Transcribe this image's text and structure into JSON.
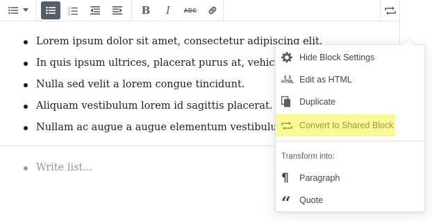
{
  "toolbar": {
    "groups": [
      {
        "name": "block-switcher",
        "icons": [
          "list-icon",
          "chevron-down-icon"
        ]
      },
      {
        "name": "list-formatting",
        "icons": [
          "bulleted-list-icon",
          "numbered-list-icon",
          "outdent-icon",
          "indent-icon"
        ],
        "active": "bulleted-list-icon"
      },
      {
        "name": "text-formatting",
        "icons": [
          "bold-icon",
          "italic-icon",
          "strikethrough-icon",
          "link-icon"
        ]
      }
    ],
    "bold_label": "B",
    "italic_label": "I",
    "strike_label": "ABC"
  },
  "side_toolbar": {
    "icon": "shared-block-icon"
  },
  "list_block": {
    "items": [
      "Lorem ipsum dolor sit amet, consectetur adipiscing elit.",
      "In quis ipsum ultrices, placerat purus at, vehicula",
      "Nulla sed velit a lorem congue tincidunt.",
      "Aliquam vestibulum lorem id sagittis placerat.",
      "Nullam ac augue a augue elementum vestibulum."
    ]
  },
  "new_block": {
    "placeholder": "Write list..."
  },
  "menu": {
    "items": [
      {
        "label": "Hide Block Settings",
        "icon": "gear-icon"
      },
      {
        "label": "Edit as HTML",
        "icon": "html-icon"
      },
      {
        "label": "Duplicate",
        "icon": "duplicate-icon"
      },
      {
        "label": "Convert to Shared Block",
        "icon": "shared-block-icon",
        "highlighted": true
      }
    ],
    "transform_label": "Transform into:",
    "transforms": [
      {
        "label": "Paragraph",
        "icon": "paragraph-icon"
      },
      {
        "label": "Quote",
        "icon": "quote-icon"
      }
    ],
    "html_glyph": "HTML",
    "paragraph_glyph": "¶",
    "quote_glyph": "“"
  },
  "colors": {
    "highlight": "#fbf997",
    "highlight_text": "#9a9c38",
    "active_button": "#555d66",
    "border": "#e2e4e7"
  }
}
